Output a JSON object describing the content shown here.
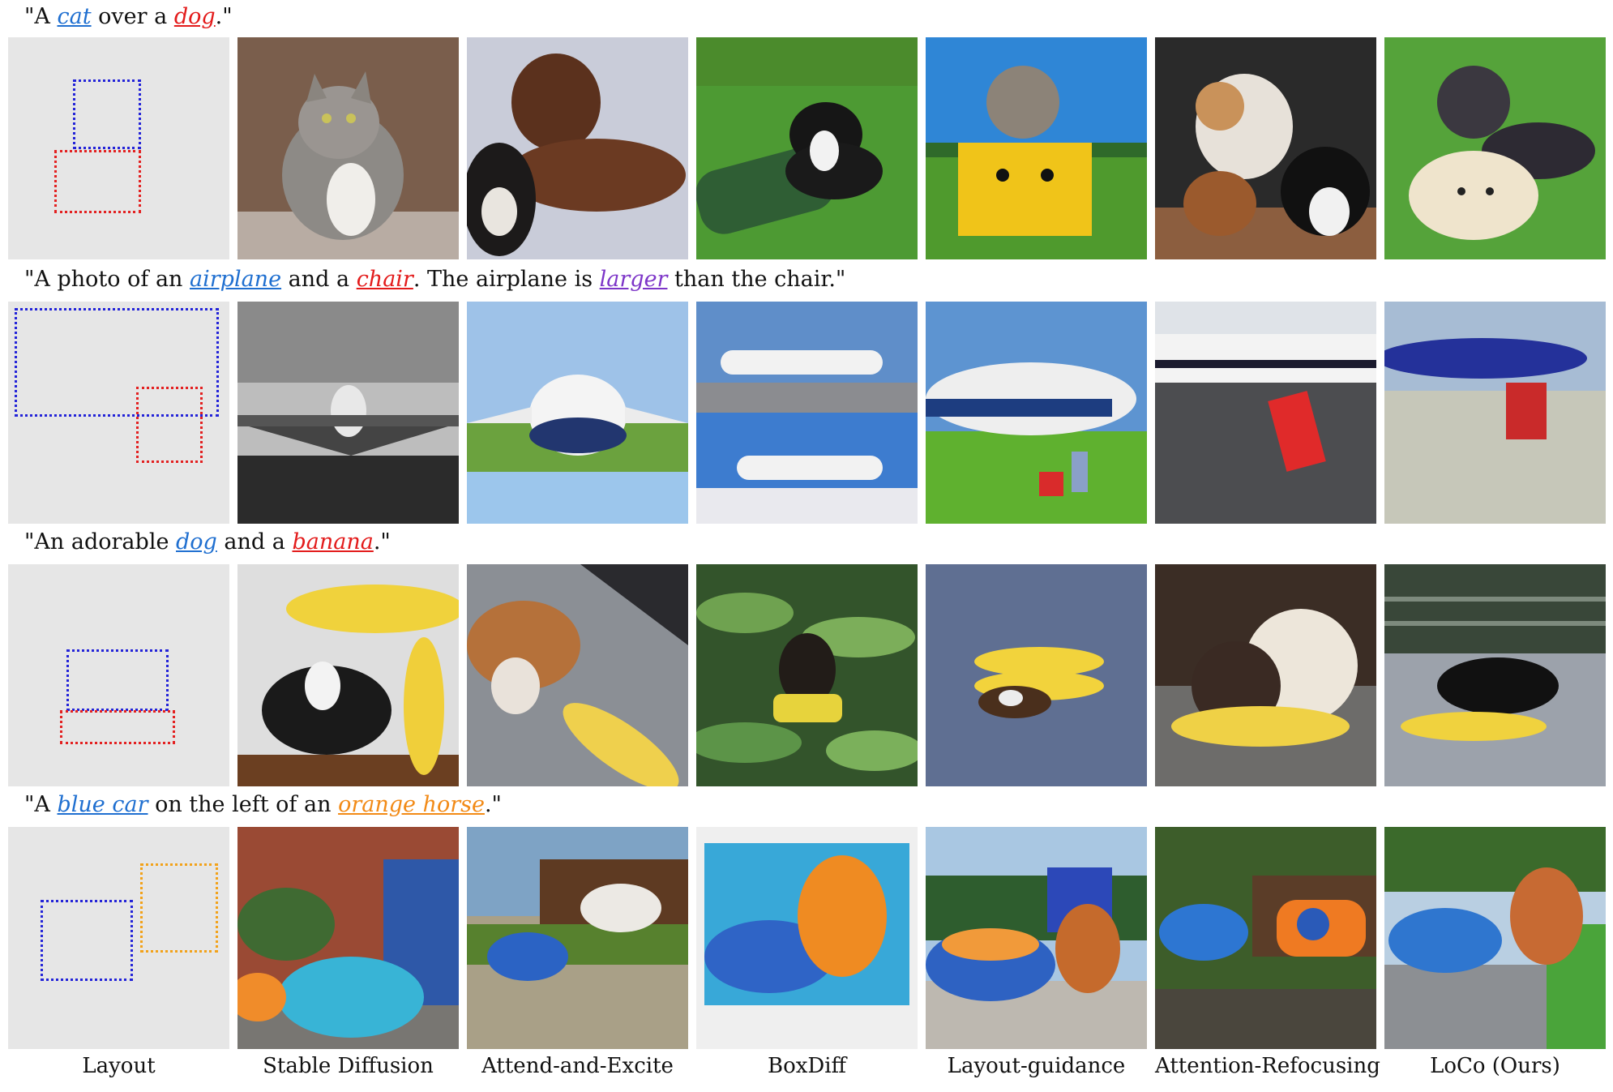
{
  "prompts": [
    {
      "pre": "\"A ",
      "t1": "cat",
      "mid1": " over a ",
      "t2": "dog",
      "post": ".\""
    },
    {
      "pre": "\"A photo of an ",
      "t1": "airplane",
      "mid1": " and a ",
      "t2": "chair",
      "mid2": ". The airplane is ",
      "t3": "larger",
      "post": " than the chair.\""
    },
    {
      "pre": "\"An adorable ",
      "t1": "dog",
      "mid1": " and a ",
      "t2": "banana",
      "post": ".\""
    },
    {
      "pre": "\"A ",
      "t1": "blue car",
      "mid1": " on the left of an ",
      "t2": "orange horse",
      "post": ".\""
    }
  ],
  "columns": [
    "Layout",
    "Stable Diffusion",
    "Attend-and-Excite",
    "BoxDiff",
    "Layout-guidance",
    "Attention-Refocusing",
    "LoCo (Ours)"
  ],
  "colors": {
    "blue_token": "#1f6fd0",
    "red_token": "#e31b1b",
    "purple_token": "#7d35c8",
    "orange_token": "#f28a16",
    "layout_bg": "#e6e6e6"
  }
}
